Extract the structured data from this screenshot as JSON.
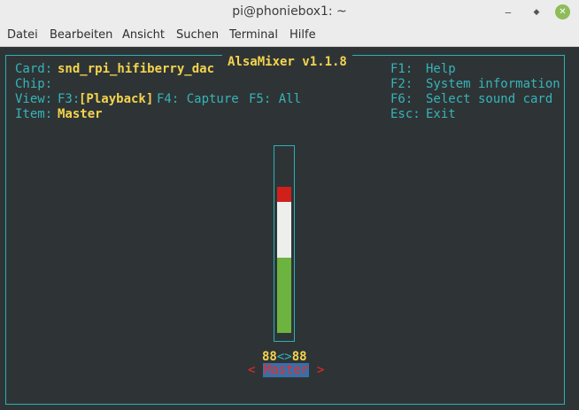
{
  "window": {
    "title": "pi@phoniebox1: ~",
    "controls": [
      "minimize-icon",
      "maximize-icon",
      "close-icon"
    ]
  },
  "menu": [
    "Datei",
    "Bearbeiten",
    "Ansicht",
    "Suchen",
    "Terminal",
    "Hilfe"
  ],
  "mixer": {
    "title": "AlsaMixer v1.1.8",
    "card_label": "Card:",
    "card_value": "snd_rpi_hifiberry_dac",
    "chip_label": "Chip:",
    "chip_value": "",
    "view_label": "View:",
    "view_f3_key": "F3:",
    "view_f3_value": "[Playback]",
    "view_f4": "F4: Capture",
    "view_f5": "F5: All",
    "item_label": "Item:",
    "item_value": "Master",
    "help": [
      {
        "key": "F1:",
        "text": "Help"
      },
      {
        "key": "F2:",
        "text": "System information"
      },
      {
        "key": "F6:",
        "text": "Select sound card"
      },
      {
        "key": "Esc:",
        "text": "Exit"
      }
    ],
    "channel": {
      "name": "Master",
      "left_volume": "88",
      "sep": "<>",
      "right_volume": "88",
      "level_percent": 88,
      "arrow_left": "<",
      "arrow_right": ">",
      "colors": {
        "high": "#d0201c",
        "mid": "#eeeeec",
        "low": "#6db33f"
      }
    }
  }
}
